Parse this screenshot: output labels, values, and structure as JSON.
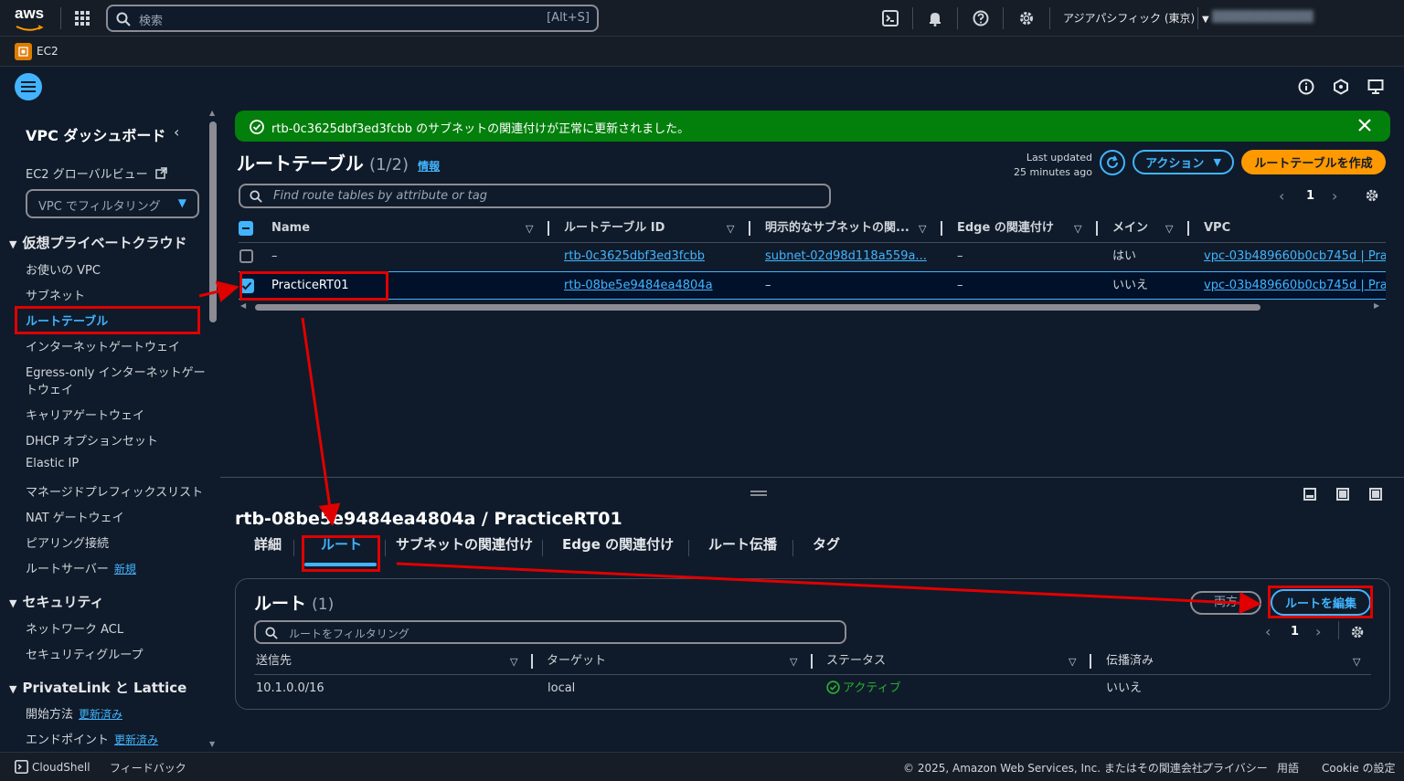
{
  "topbar": {
    "logo": "aws",
    "search_placeholder": "検索",
    "search_shortcut": "[Alt+S]",
    "region": "アジアパシフィック (東京)",
    "account_masked": "████████████"
  },
  "service_bar": {
    "service": "EC2"
  },
  "sidebar": {
    "title": "VPC ダッシュボード",
    "global_view": "EC2 グローバルビュー",
    "filter_label": "VPC でフィルタリング",
    "sections": [
      {
        "title": "仮想プライベートクラウド",
        "items": [
          "お使いの VPC",
          "サブネット",
          "ルートテーブル",
          "インターネットゲートウェイ",
          "Egress-only インターネットゲー",
          "トウェイ",
          "キャリアゲートウェイ",
          "DHCP オプションセット",
          "Elastic IP",
          "マネージドプレフィックスリスト",
          "NAT ゲートウェイ",
          "ピアリング接続",
          "ルートサーバー"
        ]
      },
      {
        "title": "セキュリティ",
        "items": [
          "ネットワーク ACL",
          "セキュリティグループ"
        ]
      },
      {
        "title": "PrivateLink と Lattice",
        "items": [
          "開始方法",
          "エンドポイント"
        ]
      }
    ],
    "badge_new": "新規",
    "badge_updated": "更新済み"
  },
  "flash": {
    "message": "rtb-0c3625dbf3ed3fcbb のサブネットの関連付けが正常に更新されました。"
  },
  "route_tables": {
    "title": "ルートテーブル",
    "count": "(1/2)",
    "info": "情報",
    "last_updated_label": "Last updated",
    "last_updated_value": "25 minutes ago",
    "actions_label": "アクション",
    "create_label": "ルートテーブルを作成",
    "search_placeholder": "Find route tables by attribute or tag",
    "page": "1",
    "columns": [
      "Name",
      "ルートテーブル ID",
      "明示的なサブネットの関...",
      "Edge の関連付け",
      "メイン",
      "VPC"
    ],
    "rows": [
      {
        "name": "–",
        "id": "rtb-0c3625dbf3ed3fcbb",
        "subnet": "subnet-02d98d118a559a...",
        "edge": "–",
        "main": "はい",
        "vpc": "vpc-03b489660b0cb745d | Pra",
        "selected": false
      },
      {
        "name": "PracticeRT01",
        "id": "rtb-08be5e9484ea4804a",
        "subnet": "–",
        "edge": "–",
        "main": "いいえ",
        "vpc": "vpc-03b489660b0cb745d | Pra",
        "selected": true
      }
    ]
  },
  "detail": {
    "heading": "rtb-08be5e9484ea4804a / PracticeRT01",
    "tabs": [
      "詳細",
      "ルート",
      "サブネットの関連付け",
      "Edge の関連付け",
      "ルート伝播",
      "タグ"
    ],
    "active_tab": 1,
    "routes": {
      "title": "ルート",
      "count": "(1)",
      "both_label": "両方",
      "edit_label": "ルートを編集",
      "filter_placeholder": "ルートをフィルタリング",
      "page": "1",
      "columns": [
        "送信先",
        "ターゲット",
        "ステータス",
        "伝播済み"
      ],
      "rows": [
        {
          "destination": "10.1.0.0/16",
          "target": "local",
          "status": "アクティブ",
          "propagated": "いいえ"
        }
      ]
    }
  },
  "footer": {
    "cloudshell": "CloudShell",
    "feedback": "フィードバック",
    "copyright": "© 2025, Amazon Web Services, Inc. またはその関連会社。",
    "privacy": "プライバシー",
    "terms": "用語",
    "cookie": "Cookie の設定"
  },
  "colors": {
    "accent": "#42b4ff",
    "primary": "#ff9900",
    "success": "#037f0c",
    "annotation": "#e00000",
    "background": "#0f1b2a"
  }
}
